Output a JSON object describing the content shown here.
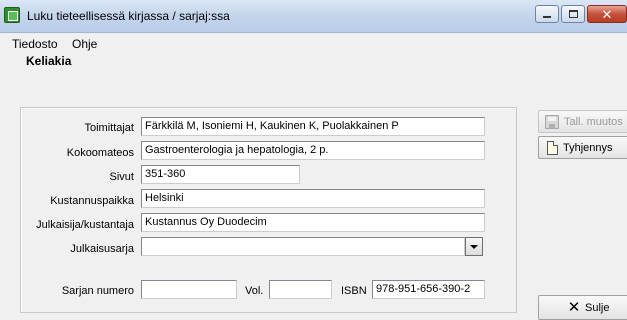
{
  "window": {
    "title": "Luku tieteellisessä kirjassa / sarjaj:ssa",
    "min_symbol": "",
    "close_symbol": "✕"
  },
  "menu": {
    "items": [
      "Tiedosto",
      "Ohje"
    ]
  },
  "heading": "Keliakia",
  "form": {
    "toimittajat": {
      "label": "Toimittajat",
      "value": "Färkkilä M, Isoniemi H, Kaukinen K, Puolakkainen P"
    },
    "kokoomateos": {
      "label": "Kokoomateos",
      "value": "Gastroenterologia ja hepatologia, 2 p."
    },
    "sivut": {
      "label": "Sivut",
      "value": "351-360"
    },
    "kustannuspaikka": {
      "label": "Kustannuspaikka",
      "value": "Helsinki"
    },
    "julkaisija": {
      "label": "Julkaisija/kustantaja",
      "value": "Kustannus Oy Duodecim"
    },
    "julkaisusarja": {
      "label": "Julkaisusarja",
      "value": ""
    },
    "sarjan_numero": {
      "label": "Sarjan numero",
      "value": ""
    },
    "vol": {
      "label": "Vol.",
      "value": ""
    },
    "isbn": {
      "label": "ISBN",
      "value": "978-951-656-390-2"
    }
  },
  "buttons": {
    "save": {
      "label": "Tall. muutos",
      "icon": "save-icon",
      "enabled": false
    },
    "clear": {
      "label": "Tyhjennys",
      "icon": "document-icon"
    },
    "close": {
      "label": "Sulje",
      "icon": "x-icon"
    }
  }
}
